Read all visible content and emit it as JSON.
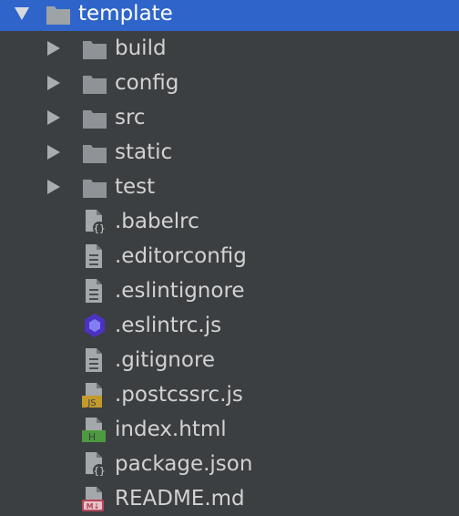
{
  "project_tree": {
    "root": {
      "name": "template",
      "expanded": true,
      "selected": true
    },
    "folders": [
      {
        "name": "build"
      },
      {
        "name": "config"
      },
      {
        "name": "src"
      },
      {
        "name": "static"
      },
      {
        "name": "test"
      }
    ],
    "files": [
      {
        "name": ".babelrc",
        "icon": "json-config-file-icon"
      },
      {
        "name": ".editorconfig",
        "icon": "text-file-icon"
      },
      {
        "name": ".eslintignore",
        "icon": "text-file-icon"
      },
      {
        "name": ".eslintrc.js",
        "icon": "eslint-hexagon-icon"
      },
      {
        "name": ".gitignore",
        "icon": "text-file-icon"
      },
      {
        "name": ".postcssrc.js",
        "icon": "javascript-file-icon",
        "badge": "JS"
      },
      {
        "name": "index.html",
        "icon": "html-file-icon",
        "badge": "H"
      },
      {
        "name": "package.json",
        "icon": "json-config-file-icon"
      },
      {
        "name": "README.md",
        "icon": "markdown-file-icon",
        "badge": "M↓"
      }
    ]
  },
  "colors": {
    "background": "#3c3f41",
    "selection": "#2f65ca",
    "folder": "#8e9398",
    "text": "#d2d2d2",
    "eslint": "#4b32c3",
    "js_badge": "#c49a2c",
    "html_badge": "#4d9a3f",
    "markdown_badge": "#b4475a"
  }
}
